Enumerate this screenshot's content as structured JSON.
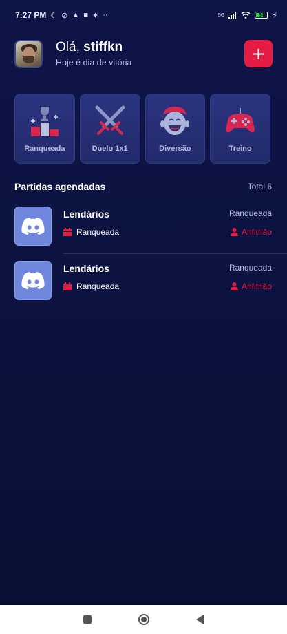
{
  "status_bar": {
    "time": "7:27 PM",
    "left_icons": [
      "moon-icon",
      "mute-icon",
      "app-icon",
      "notification-icon",
      "sparkle-icon",
      "more-dots-icon"
    ],
    "right_icons": [
      "signal-icon",
      "wifi-icon",
      "battery-icon",
      "charging-icon"
    ],
    "network": "5G",
    "battery_level": "84"
  },
  "header": {
    "greeting": "Olá,",
    "username": "stiffkn",
    "subtitle": "Hoje é dia de vitória",
    "add_label": "+"
  },
  "categories": [
    {
      "label": "Ranqueada",
      "icon": "podium-trophy-icon"
    },
    {
      "label": "Duelo 1x1",
      "icon": "crossed-swords-icon"
    },
    {
      "label": "Diversão",
      "icon": "laughing-face-icon"
    },
    {
      "label": "Treino",
      "icon": "gamepad-icon"
    }
  ],
  "scheduled": {
    "title": "Partidas agendadas",
    "total": "Total 6",
    "matches": [
      {
        "name": "Lendários",
        "mode": "Ranqueada",
        "category": "Ranqueada",
        "role": "Anfitrião"
      },
      {
        "name": "Lendários",
        "mode": "Ranqueada",
        "category": "Ranqueada",
        "role": "Anfitrião"
      }
    ]
  },
  "colors": {
    "background": "#0e1547",
    "accent": "#e51c44",
    "card": "#2b3480",
    "discord": "#6f86dc"
  }
}
